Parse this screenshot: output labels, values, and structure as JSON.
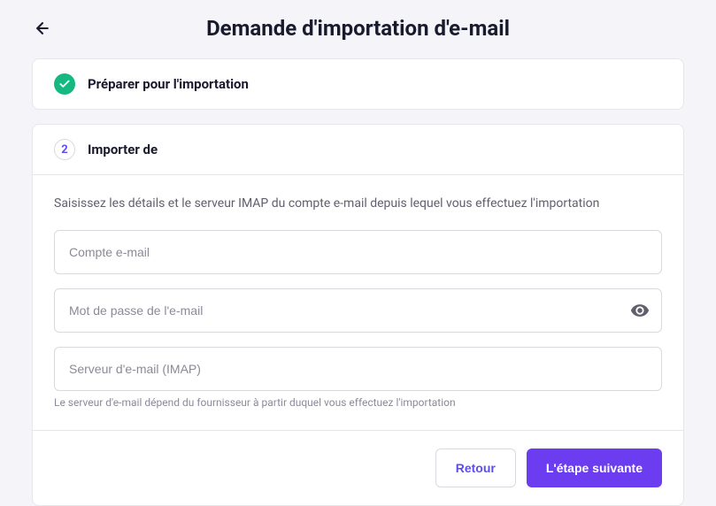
{
  "header": {
    "title": "Demande d'importation d'e-mail"
  },
  "step1": {
    "label": "Préparer pour l'importation"
  },
  "step2": {
    "number": "2",
    "label": "Importer de",
    "instructions": "Saisissez les détails et le serveur IMAP du compte e-mail depuis lequel vous effectuez l'importation",
    "email_placeholder": "Compte e-mail",
    "password_placeholder": "Mot de passe de l'e-mail",
    "server_placeholder": "Serveur d'e-mail (IMAP)",
    "server_helper": "Le serveur d'e-mail dépend du fournisseur à partir duquel vous effectuez l'importation"
  },
  "footer": {
    "back_label": "Retour",
    "next_label": "L'étape suivante"
  }
}
